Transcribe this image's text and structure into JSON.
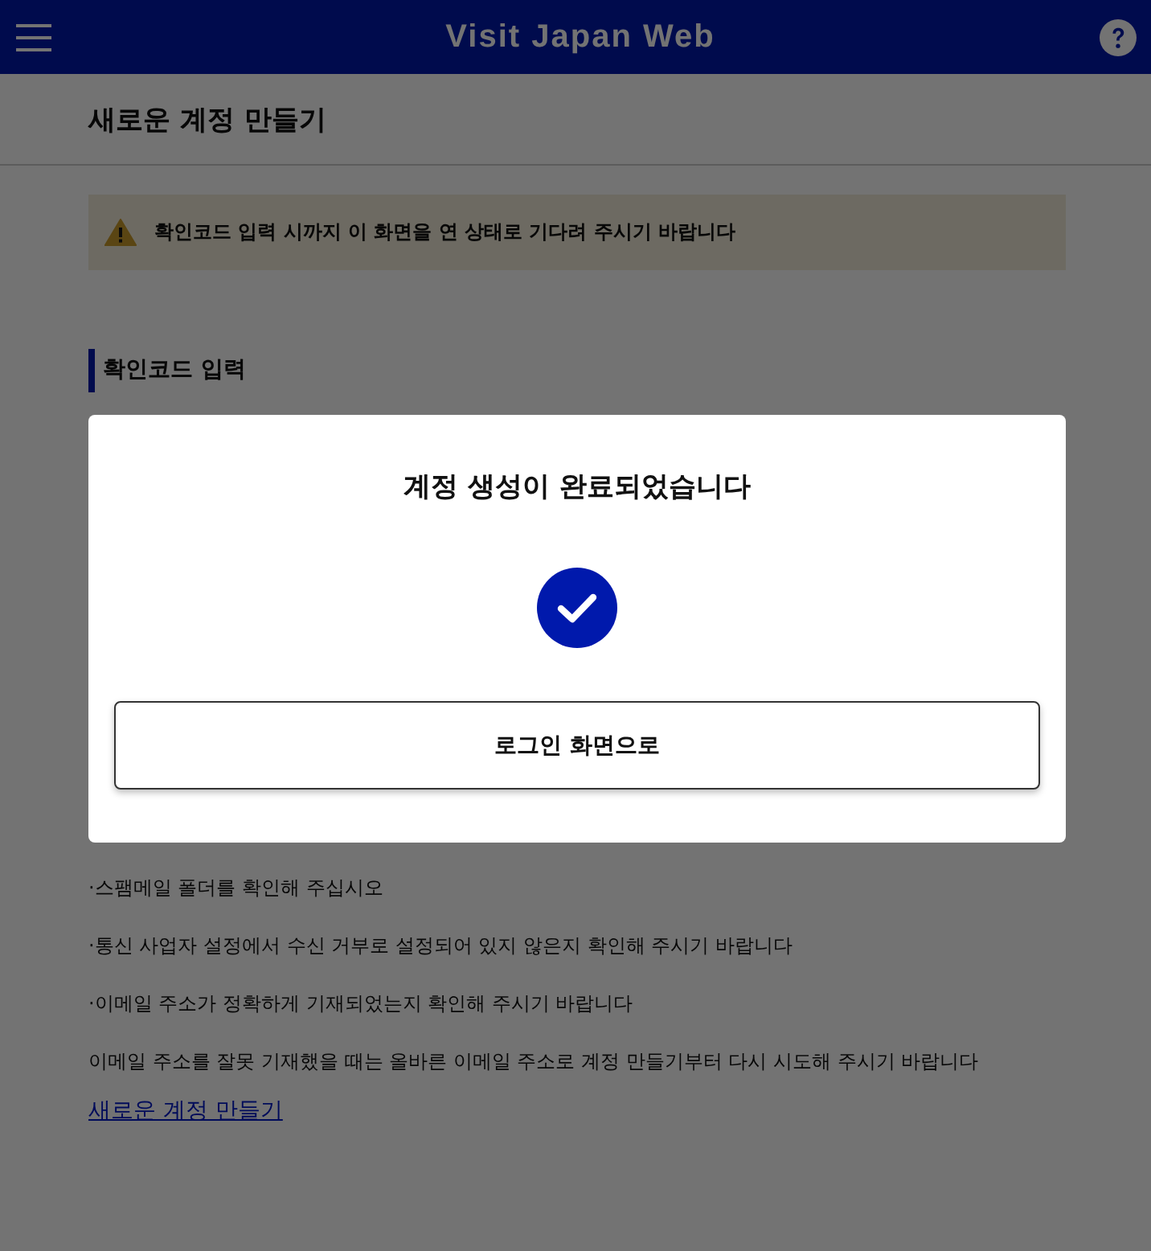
{
  "header": {
    "title": "Visit Japan Web"
  },
  "page": {
    "title": "새로운 계정 만들기",
    "warning": "확인코드 입력 시까지 이 화면을 연 상태로 기다려 주시기 바랍니다",
    "section_heading": "확인코드 입력",
    "notes": [
      "·스팸메일 폴더를 확인해 주십시오",
      "·통신 사업자 설정에서 수신 거부로 설정되어 있지 않은지 확인해 주시기 바랍니다",
      "·이메일 주소가 정확하게 기재되었는지 확인해 주시기 바랍니다"
    ],
    "retry_note": "이메일 주소를 잘못 기재했을 때는 올바른 이메일 주소로 계정 만들기부터 다시 시도해 주시기 바랍니다",
    "link": "새로운 계정 만들기"
  },
  "dialog": {
    "title": "계정 생성이 완료되었습니다",
    "button": "로그인 화면으로"
  }
}
